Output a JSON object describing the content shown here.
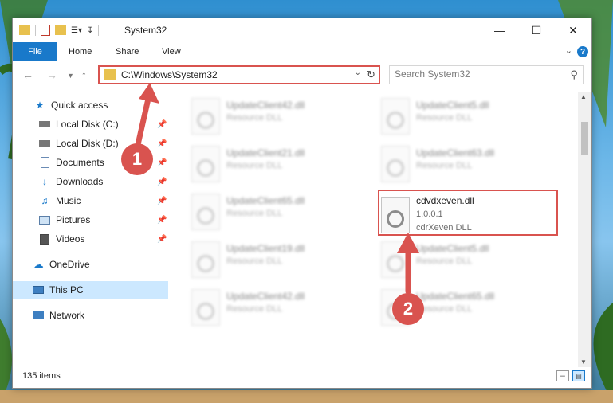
{
  "window": {
    "title": "System32",
    "tabs": {
      "file": "File",
      "home": "Home",
      "share": "Share",
      "view": "View"
    },
    "help": "?"
  },
  "nav": {
    "address": "C:\\Windows\\System32",
    "search_placeholder": "Search System32"
  },
  "sidebar": {
    "items": [
      {
        "label": "Quick access",
        "icon": "star-icon"
      },
      {
        "label": "Local Disk (C:)",
        "icon": "drive-icon",
        "pinned": true
      },
      {
        "label": "Local Disk (D:)",
        "icon": "drive-icon",
        "pinned": true
      },
      {
        "label": "Documents",
        "icon": "documents-icon",
        "pinned": true
      },
      {
        "label": "Downloads",
        "icon": "downloads-icon",
        "pinned": true
      },
      {
        "label": "Music",
        "icon": "music-icon",
        "pinned": true
      },
      {
        "label": "Pictures",
        "icon": "pictures-icon",
        "pinned": true
      },
      {
        "label": "Videos",
        "icon": "videos-icon",
        "pinned": true
      },
      {
        "label": "OneDrive",
        "icon": "onedrive-icon"
      },
      {
        "label": "This PC",
        "icon": "pc-icon",
        "selected": true
      },
      {
        "label": "Network",
        "icon": "network-icon"
      }
    ]
  },
  "files": [
    {
      "name": "UpdateClient42.dll",
      "type": "Resource DLL"
    },
    {
      "name": "UpdateClient5.dll",
      "type": "Resource DLL"
    },
    {
      "name": "UpdateClient21.dll",
      "type": "Resource DLL"
    },
    {
      "name": "UpdateClient63.dll",
      "type": "Resource DLL"
    },
    {
      "name": "UpdateClient65.dll",
      "type": "Resource DLL"
    },
    {
      "name": "cdvdxeven.dll",
      "version": "1.0.0.1",
      "type": "cdrXeven DLL"
    },
    {
      "name": "UpdateClient19.dll",
      "type": "Resource DLL"
    },
    {
      "name": "UpdateClient5.dll",
      "type": "Resource DLL"
    },
    {
      "name": "UpdateClient42.dll",
      "type": "Resource DLL"
    },
    {
      "name": "UpdateClient65.dll",
      "type": "Resource DLL"
    }
  ],
  "status": {
    "items": "135 items"
  },
  "annotations": {
    "step1": "1",
    "step2": "2"
  },
  "colors": {
    "accent": "#1979ca",
    "highlight": "#d9534f"
  }
}
